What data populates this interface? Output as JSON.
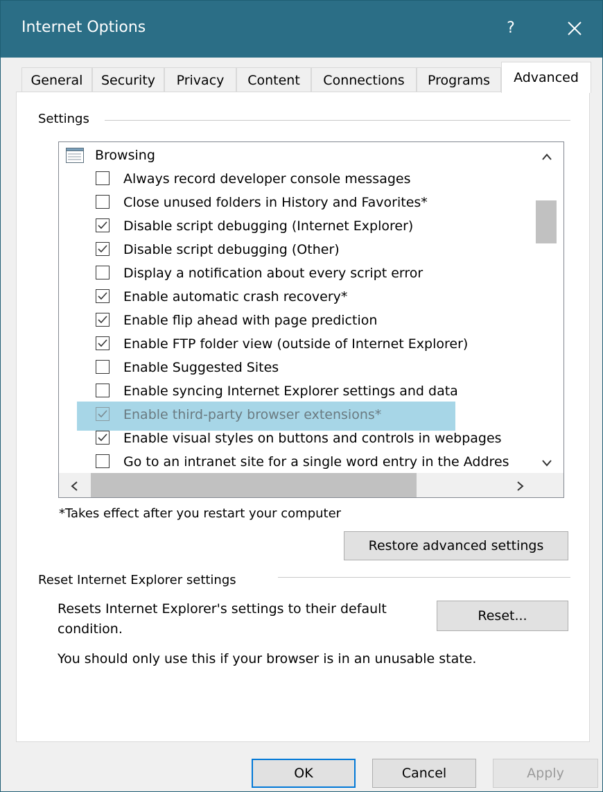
{
  "window": {
    "title": "Internet Options",
    "help_label": "?"
  },
  "tabs": [
    {
      "label": "General"
    },
    {
      "label": "Security"
    },
    {
      "label": "Privacy"
    },
    {
      "label": "Content"
    },
    {
      "label": "Connections"
    },
    {
      "label": "Programs"
    },
    {
      "label": "Advanced",
      "active": true
    }
  ],
  "settings": {
    "group_label": "Settings",
    "tree_root": "Browsing",
    "items": [
      {
        "label": "Always record developer console messages",
        "checked": false
      },
      {
        "label": "Close unused folders in History and Favorites*",
        "checked": false
      },
      {
        "label": "Disable script debugging (Internet Explorer)",
        "checked": true
      },
      {
        "label": "Disable script debugging (Other)",
        "checked": true
      },
      {
        "label": "Display a notification about every script error",
        "checked": false
      },
      {
        "label": "Enable automatic crash recovery*",
        "checked": true
      },
      {
        "label": "Enable flip ahead with page prediction",
        "checked": true
      },
      {
        "label": "Enable FTP folder view (outside of Internet Explorer)",
        "checked": true
      },
      {
        "label": "Enable Suggested Sites",
        "checked": false
      },
      {
        "label": "Enable syncing Internet Explorer settings and data",
        "checked": false
      },
      {
        "label": "Enable third-party browser extensions*",
        "checked": true,
        "selected": true
      },
      {
        "label": "Enable visual styles on buttons and controls in webpages",
        "checked": true
      },
      {
        "label": "Go to an intranet site for a single word entry in the Addres",
        "checked": false
      }
    ],
    "restart_note": "*Takes effect after you restart your computer",
    "restore_label": "Restore advanced settings"
  },
  "reset": {
    "group_label": "Reset Internet Explorer settings",
    "desc_line1": "Resets Internet Explorer's settings to their default",
    "desc_line2": "condition.",
    "button_label": "Reset...",
    "warning": "You should only use this if your browser is in an unusable state."
  },
  "footer": {
    "ok_label": "OK",
    "cancel_label": "Cancel",
    "apply_label": "Apply"
  }
}
